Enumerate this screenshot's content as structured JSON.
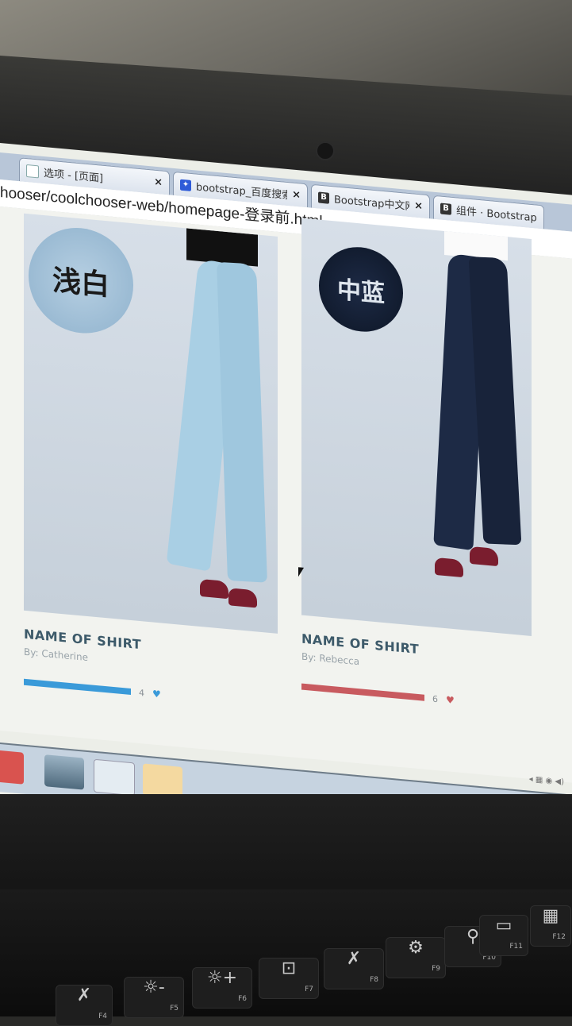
{
  "browser": {
    "tabs": [
      {
        "label": "选项 - [页面]",
        "icon": "page-icon"
      },
      {
        "label": "bootstrap_百度搜索",
        "icon": "baidu-paw-icon"
      },
      {
        "label": "Bootstrap中文网",
        "icon": "bootstrap-icon"
      },
      {
        "label": "组件 · Bootstrap 中",
        "icon": "bootstrap-icon"
      }
    ],
    "tab_close_glyph": "×",
    "address": "hooser/coolchooser-web/homepage-登录前.html"
  },
  "products": [
    {
      "swatch_label": "浅白",
      "name": "NAME OF SHIRT",
      "by": "By: Catherine",
      "likes": "4",
      "like_fraction": 0.85,
      "bar_color": "#3a9ad9",
      "heart_color": "#3a9ad9",
      "jeans_color": "#a9cfe4"
    },
    {
      "swatch_label": "中蓝",
      "name": "NAME OF SHIRT",
      "by": "By: Rebecca",
      "likes": "6",
      "like_fraction": 0.85,
      "bar_color": "#c85a5f",
      "heart_color": "#c85a5f",
      "jeans_color": "#1d2a45"
    }
  ],
  "icons": {
    "heart": "♥"
  },
  "keyboard": {
    "keys": [
      {
        "glyph": "✗",
        "fn": "F4"
      },
      {
        "glyph": "☼-",
        "fn": "F5"
      },
      {
        "glyph": "☼+",
        "fn": "F6"
      },
      {
        "glyph": "⊡",
        "fn": "F7"
      },
      {
        "glyph": "✗",
        "fn": "F8"
      },
      {
        "glyph": "⚙",
        "fn": "F9"
      },
      {
        "glyph": "⚲",
        "fn": "F10"
      },
      {
        "glyph": "▭",
        "fn": "F11"
      },
      {
        "glyph": "▦",
        "fn": "F12"
      }
    ]
  }
}
